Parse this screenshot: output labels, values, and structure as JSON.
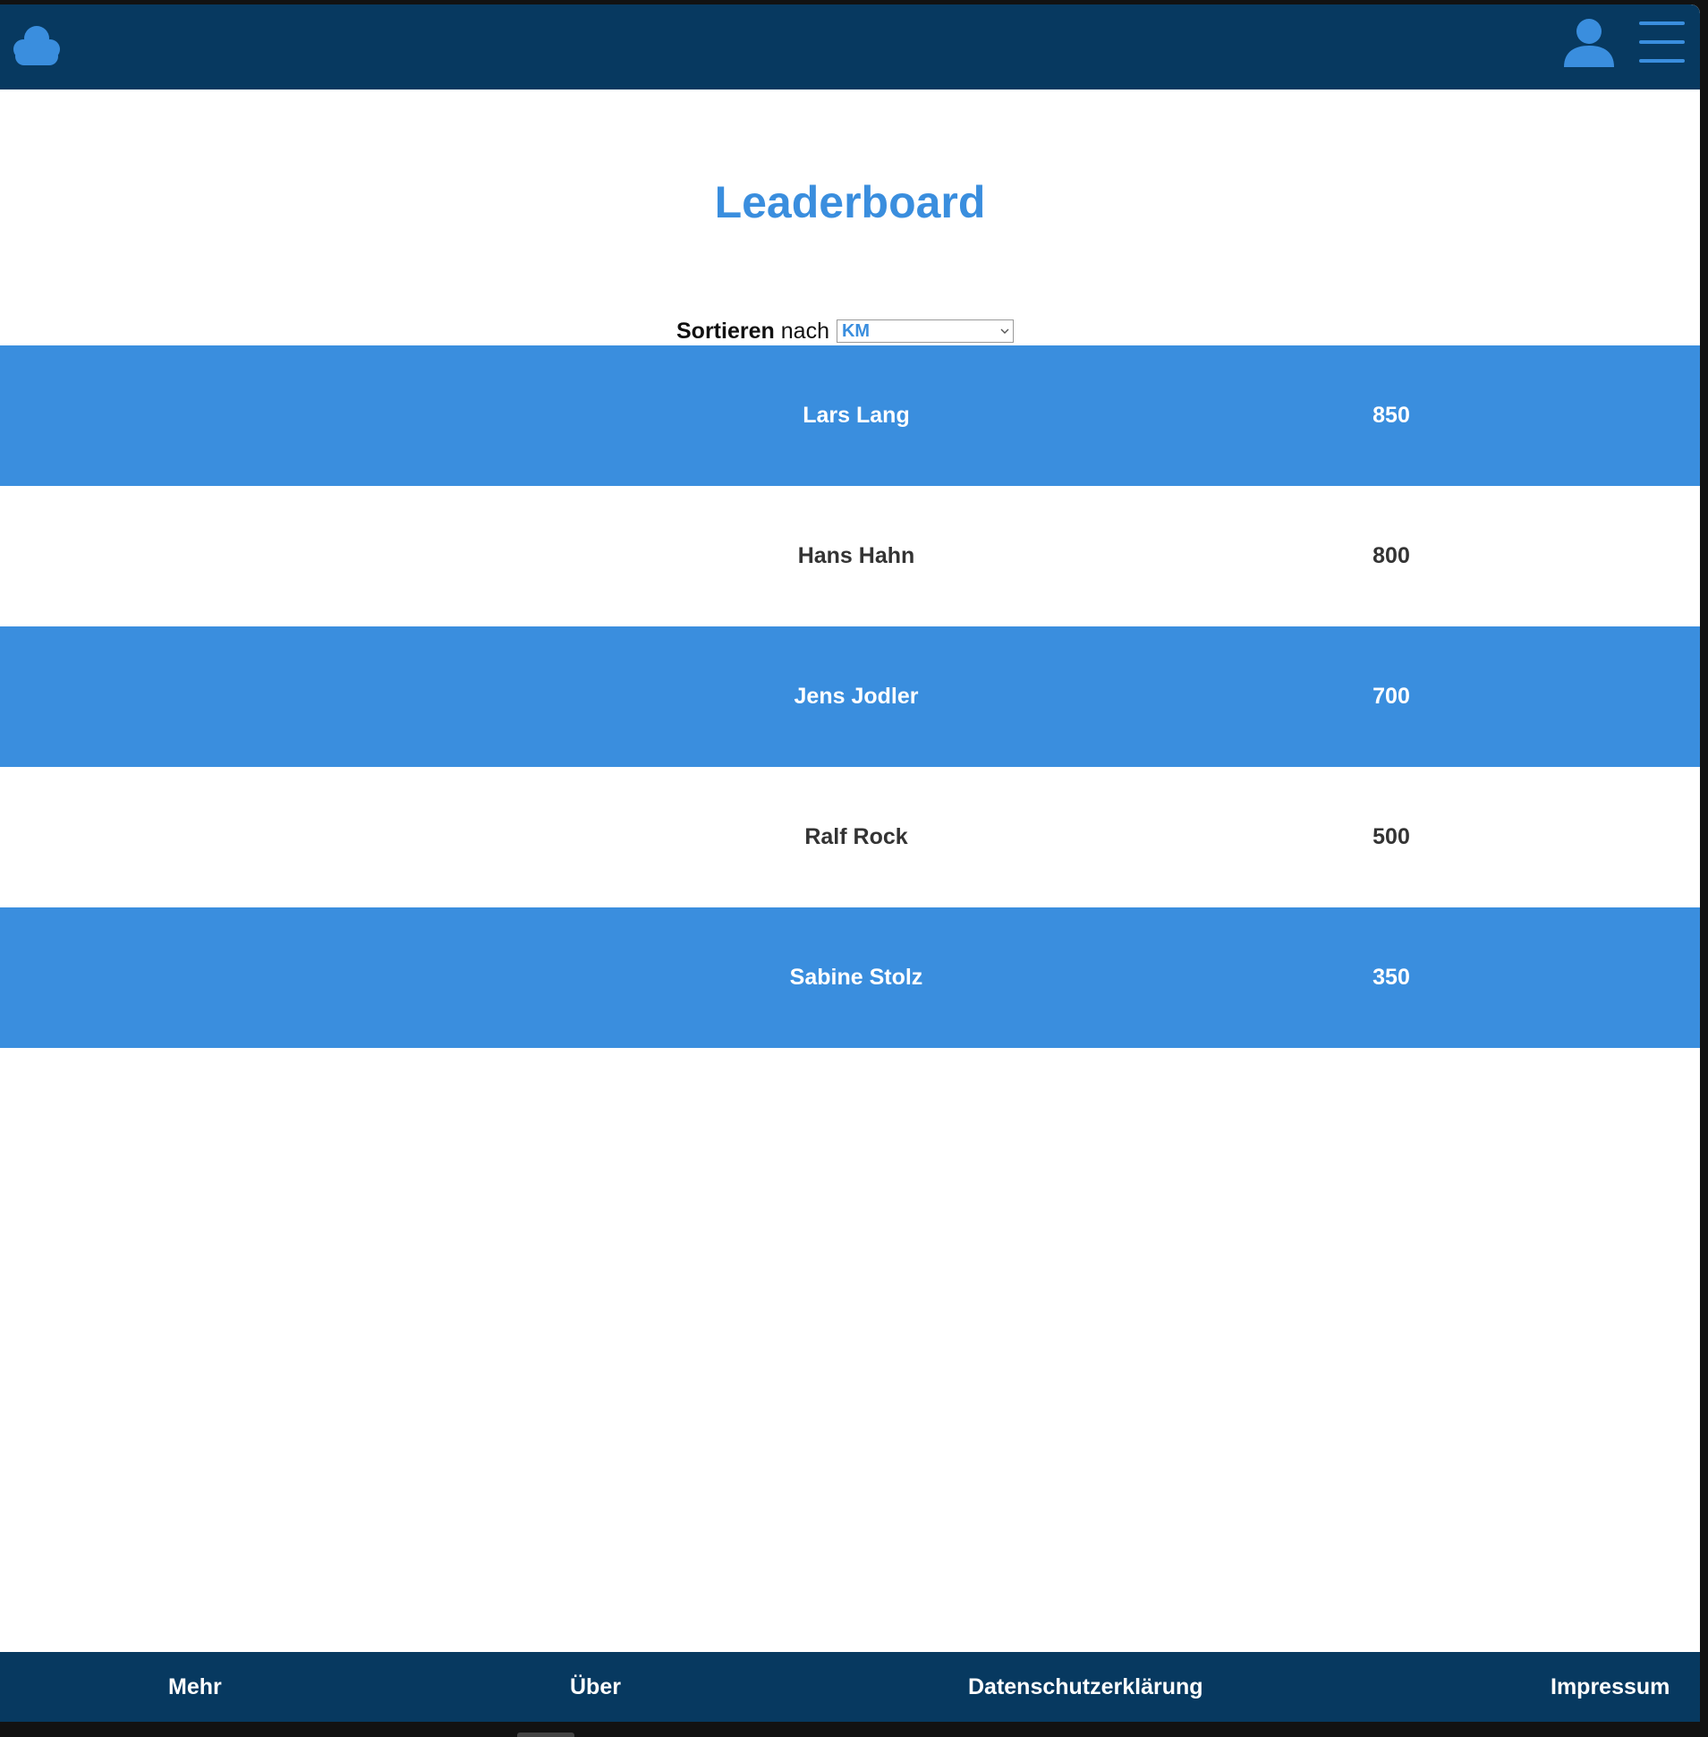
{
  "header": {
    "logo_icon": "cloud-icon",
    "user_icon": "user-icon",
    "menu_icon": "hamburger-menu-icon",
    "accent_color": "#3a8ede",
    "bar_color": "#073960"
  },
  "main": {
    "title": "Leaderboard",
    "sort": {
      "label": "Sortieren",
      "connector": "nach",
      "selected": "KM"
    },
    "rows": [
      {
        "name": "Lars Lang",
        "score": "850"
      },
      {
        "name": "Hans Hahn",
        "score": "800"
      },
      {
        "name": "Jens Jodler",
        "score": "700"
      },
      {
        "name": "Ralf Rock",
        "score": "500"
      },
      {
        "name": "Sabine Stolz",
        "score": "350"
      }
    ]
  },
  "footer": {
    "links": [
      "Mehr",
      "Über",
      "Datenschutzerklärung",
      "Impressum"
    ]
  }
}
